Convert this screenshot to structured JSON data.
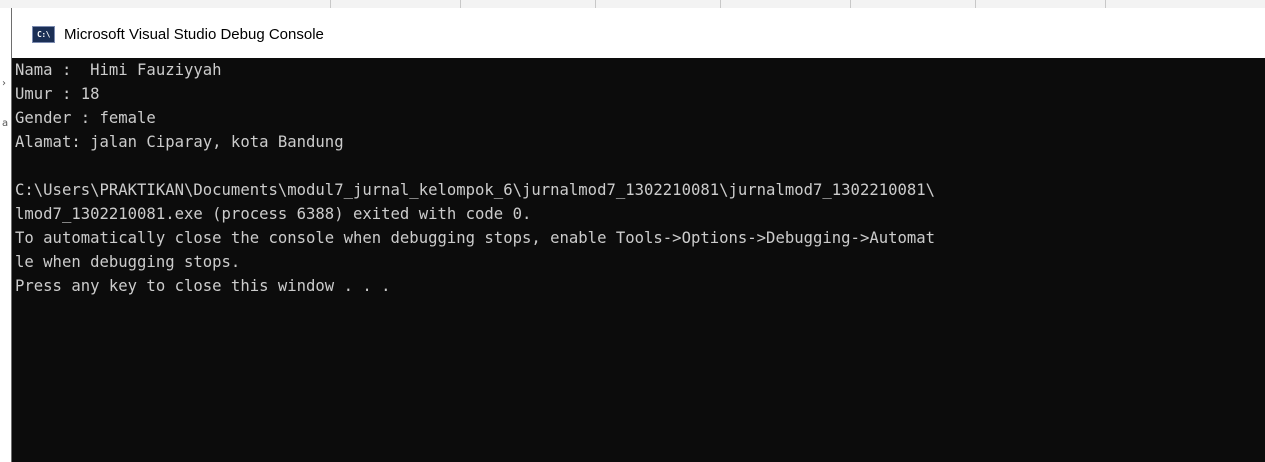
{
  "window": {
    "title": "Microsoft Visual Studio Debug Console",
    "icon_text": "C:\\"
  },
  "console": {
    "lines": [
      "Nama :  Himi Fauziyyah",
      "Umur : 18",
      "Gender : female",
      "Alamat: jalan Ciparay, kota Bandung",
      "",
      "C:\\Users\\PRAKTIKAN\\Documents\\modul7_jurnal_kelompok_6\\jurnalmod7_1302210081\\jurnalmod7_1302210081\\",
      "lmod7_1302210081.exe (process 6388) exited with code 0.",
      "To automatically close the console when debugging stops, enable Tools->Options->Debugging->Automat",
      "le when debugging stops.",
      "Press any key to close this window . . ."
    ]
  },
  "colors": {
    "console_bg": "#0c0c0c",
    "console_text": "#cccccc",
    "titlebar_bg": "#ffffff"
  },
  "icons": {
    "app": "console-app-icon"
  }
}
